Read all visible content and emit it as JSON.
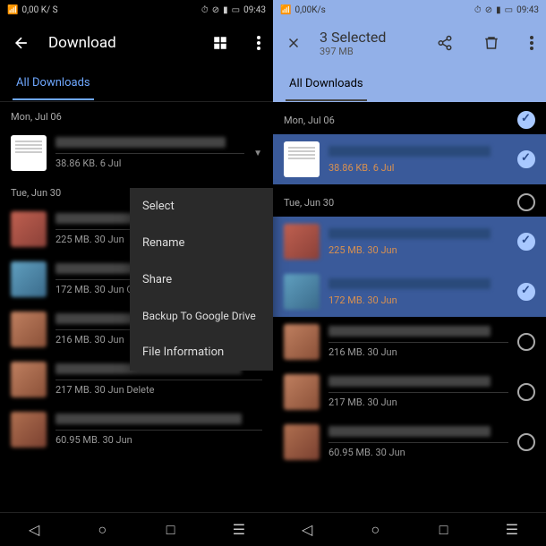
{
  "status": {
    "speed": "0,00 K/ S",
    "speed2": "0,00K/s",
    "time": "09:43"
  },
  "left": {
    "title": "Download",
    "tab": "All Downloads",
    "sections": [
      {
        "date": "Mon, Jul 06"
      },
      {
        "date": "Tue, Jun 30"
      }
    ],
    "files": {
      "f0": {
        "meta": "38.86 KB. 6 Jul"
      },
      "f1": {
        "meta": "225 MB. 30 Jun"
      },
      "f2": {
        "meta": "172 MB. 30 Jun",
        "open_with": "Open With"
      },
      "f3": {
        "meta": "216 MB. 30 Jun"
      },
      "f4": {
        "meta": "217 MB. 30 Jun",
        "delete": "Delete"
      },
      "f5": {
        "meta": "60.95 MB. 30 Jun"
      }
    },
    "popup": {
      "select": "Select",
      "rename": "Rename",
      "share": "Share",
      "backup": "Backup To Google Drive",
      "info": "File Information"
    }
  },
  "right": {
    "title": "3 Selected",
    "subtitle": "397 MB",
    "tab": "All Downloads",
    "sections": [
      {
        "date": "Mon, Jul 06"
      },
      {
        "date": "Tue, Jun 30"
      }
    ],
    "files": {
      "f0": {
        "meta": "38.86 KB. 6 Jul"
      },
      "f1": {
        "meta": "225 MB. 30 Jun"
      },
      "f2": {
        "meta": "172 MB. 30 Jun"
      },
      "f3": {
        "meta": "216 MB. 30 Jun"
      },
      "f4": {
        "meta": "217 MB. 30 Jun"
      },
      "f5": {
        "meta": "60.95 MB. 30 Jun"
      }
    }
  }
}
